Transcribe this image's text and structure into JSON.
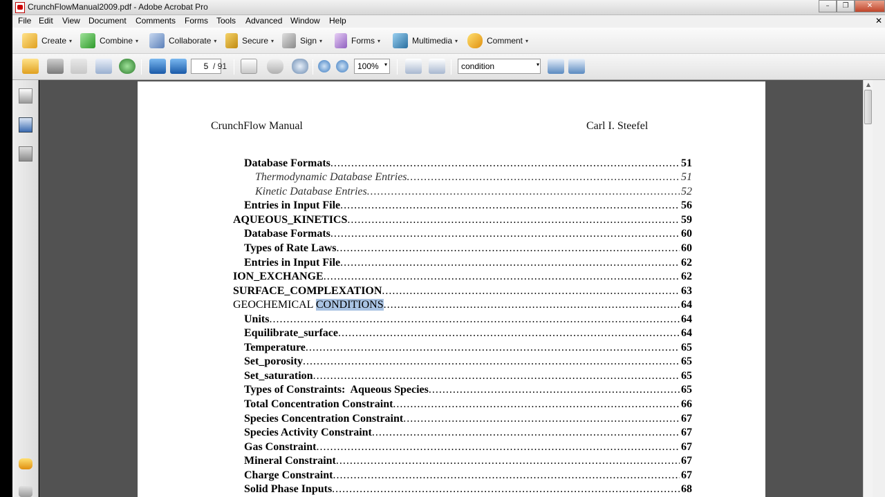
{
  "window": {
    "title": "CrunchFlowManual2009.pdf - Adobe Acrobat Pro",
    "minimize_label": "–",
    "maximize_label": "❐",
    "close_label": "✕",
    "doc_close_label": "✕"
  },
  "menu": [
    "File",
    "Edit",
    "View",
    "Document",
    "Comments",
    "Forms",
    "Tools",
    "Advanced",
    "Window",
    "Help"
  ],
  "tasks": {
    "create": "Create",
    "combine": "Combine",
    "collaborate": "Collaborate",
    "secure": "Secure",
    "sign": "Sign",
    "forms": "Forms",
    "multimedia": "Multimedia",
    "comment": "Comment",
    "dropdown_glyph": "▾"
  },
  "navbar": {
    "page_current": "5",
    "page_total": "/ 91",
    "zoom": "100%",
    "search_value": "condition",
    "dropdown_glyph": "▾"
  },
  "document": {
    "header_left": "CrunchFlow Manual",
    "header_right": "Carl I. Steefel",
    "toc": [
      {
        "title": "Database Formats",
        "page": "51"
      },
      {
        "title": "Thermodynamic Database Entries",
        "page": "51"
      },
      {
        "title": "Kinetic Database Entries",
        "page": "52"
      },
      {
        "title": "Entries in Input File",
        "page": "56"
      },
      {
        "title": "AQUEOUS_KINETICS",
        "page": "59"
      },
      {
        "title": "Database Formats",
        "page": "60"
      },
      {
        "title": "Types of Rate Laws",
        "page": "60"
      },
      {
        "title": "Entries in Input File",
        "page": "62"
      },
      {
        "title": "ION_EXCHANGE",
        "page": "62"
      },
      {
        "title": "SURFACE_COMPLEXATION",
        "page": "63"
      },
      {
        "title_prefix": "GEOCHEMICAL ",
        "title_highlight": "CONDITIONS",
        "page": "64"
      },
      {
        "title": "Units",
        "page": "64"
      },
      {
        "title": "Equilibrate_surface",
        "page": "64"
      },
      {
        "title": "Temperature",
        "page": "65"
      },
      {
        "title": "Set_porosity",
        "page": "65"
      },
      {
        "title": "Set_saturation",
        "page": "65"
      },
      {
        "title": "Types of Constraints:  Aqueous Species",
        "page": "65"
      },
      {
        "title": "Total Concentration Constraint",
        "page": "66"
      },
      {
        "title": "Species Concentration Constraint",
        "page": "67"
      },
      {
        "title": "Species Activity Constraint",
        "page": "67"
      },
      {
        "title": "Gas Constraint",
        "page": "67"
      },
      {
        "title": "Mineral Constraint",
        "page": "67"
      },
      {
        "title": "Charge Constraint",
        "page": "67"
      },
      {
        "title": "Solid Phase Inputs",
        "page": "68"
      }
    ]
  },
  "scrollbar": {
    "up_glyph": "▲"
  }
}
